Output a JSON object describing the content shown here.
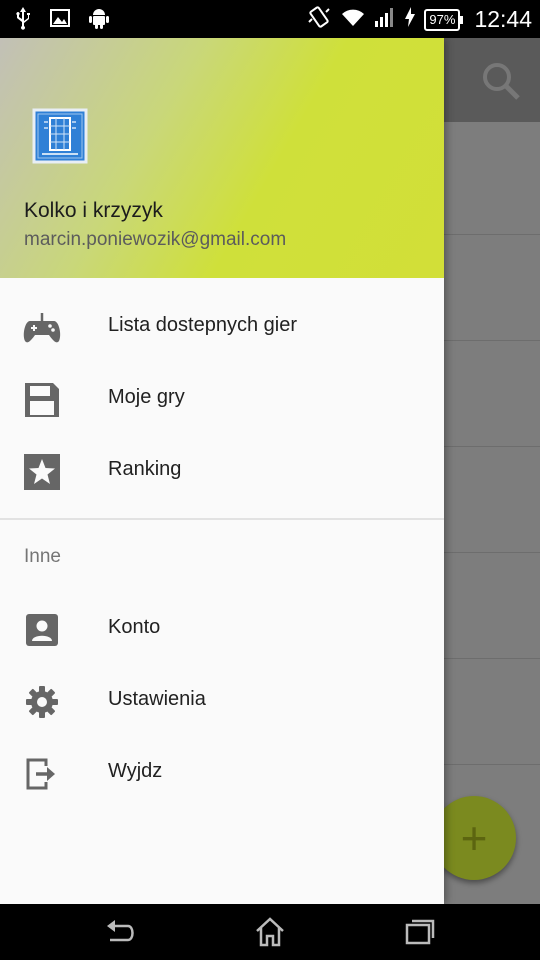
{
  "status_bar": {
    "left_icons": [
      "usb-icon",
      "image-icon",
      "android-icon"
    ],
    "right_icons": [
      "vibrate-icon",
      "wifi-icon",
      "signal-icon",
      "charging-icon"
    ],
    "battery": "97%",
    "time": "12:44"
  },
  "drawer": {
    "header": {
      "name": "Kolko i krzyzyk",
      "email": "marcin.poniewozik@gmail.com"
    },
    "items": [
      {
        "label": "Lista dostepnych gier",
        "icon": "gamepad-icon"
      },
      {
        "label": "Moje gry",
        "icon": "save-icon"
      },
      {
        "label": "Ranking",
        "icon": "star-icon"
      }
    ],
    "section_label": "Inne",
    "secondary_items": [
      {
        "label": "Konto",
        "icon": "account-icon"
      },
      {
        "label": "Ustawienia",
        "icon": "settings-icon"
      },
      {
        "label": "Wyjdz",
        "icon": "exit-icon"
      }
    ]
  },
  "fab": {
    "label": "+"
  },
  "colors": {
    "header_accent": "#CDDC39",
    "drawer_bg": "#FAFAFA",
    "icon_gray": "#666666"
  },
  "nav_bar": [
    "back-icon",
    "home-icon",
    "recents-icon"
  ]
}
